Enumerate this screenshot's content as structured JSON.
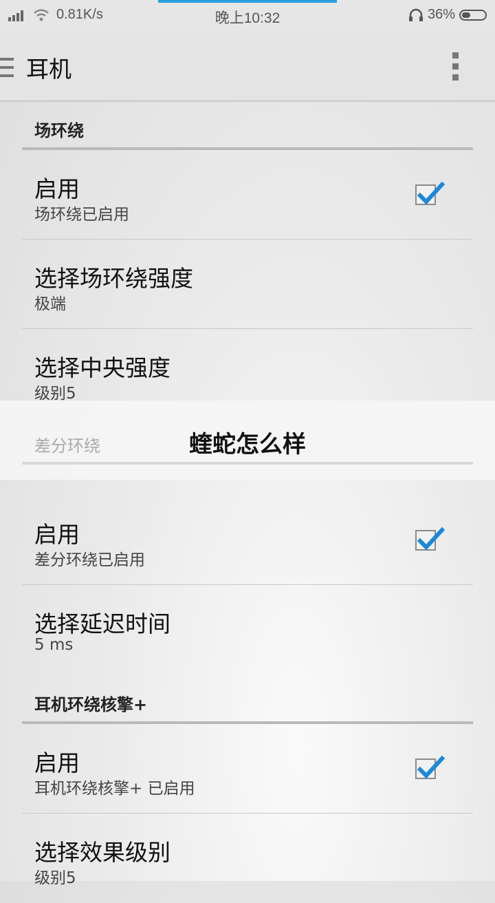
{
  "status_bar": {
    "network_speed": "0.81K/s",
    "time": "晚上10:32",
    "battery_percent": "36%",
    "battery_level": 0.36,
    "icons": [
      "signal-icon",
      "wifi-icon",
      "headphone-icon",
      "battery-icon"
    ]
  },
  "app_bar": {
    "title": "耳机",
    "icons": [
      "menu-icon",
      "overflow-menu-icon"
    ]
  },
  "sections": {
    "field_surround": {
      "header": "场环绕",
      "enable_title": "启用",
      "enable_summary": "场环绕已启用",
      "enable_checked": true,
      "strength_title": "选择场环绕强度",
      "strength_value": "极端",
      "center_title": "选择中央强度",
      "center_value": "级别5"
    },
    "diff_surround": {
      "header": "差分环绕",
      "enable_title": "启用",
      "enable_summary": "差分环绕已启用",
      "enable_checked": true,
      "delay_title": "选择延迟时间",
      "delay_value": "5 ms"
    },
    "headphone_engine": {
      "header": "耳机环绕核擎+",
      "enable_title": "启用",
      "enable_summary": "耳机环绕核擎+ 已启用",
      "enable_checked": true,
      "effect_title": "选择效果级别",
      "effect_value": "级别5"
    }
  },
  "overlay_banner": {
    "text": "蝰蛇怎么样"
  },
  "colors": {
    "accent": "#2a9fdc",
    "check": "#1e88d8"
  }
}
